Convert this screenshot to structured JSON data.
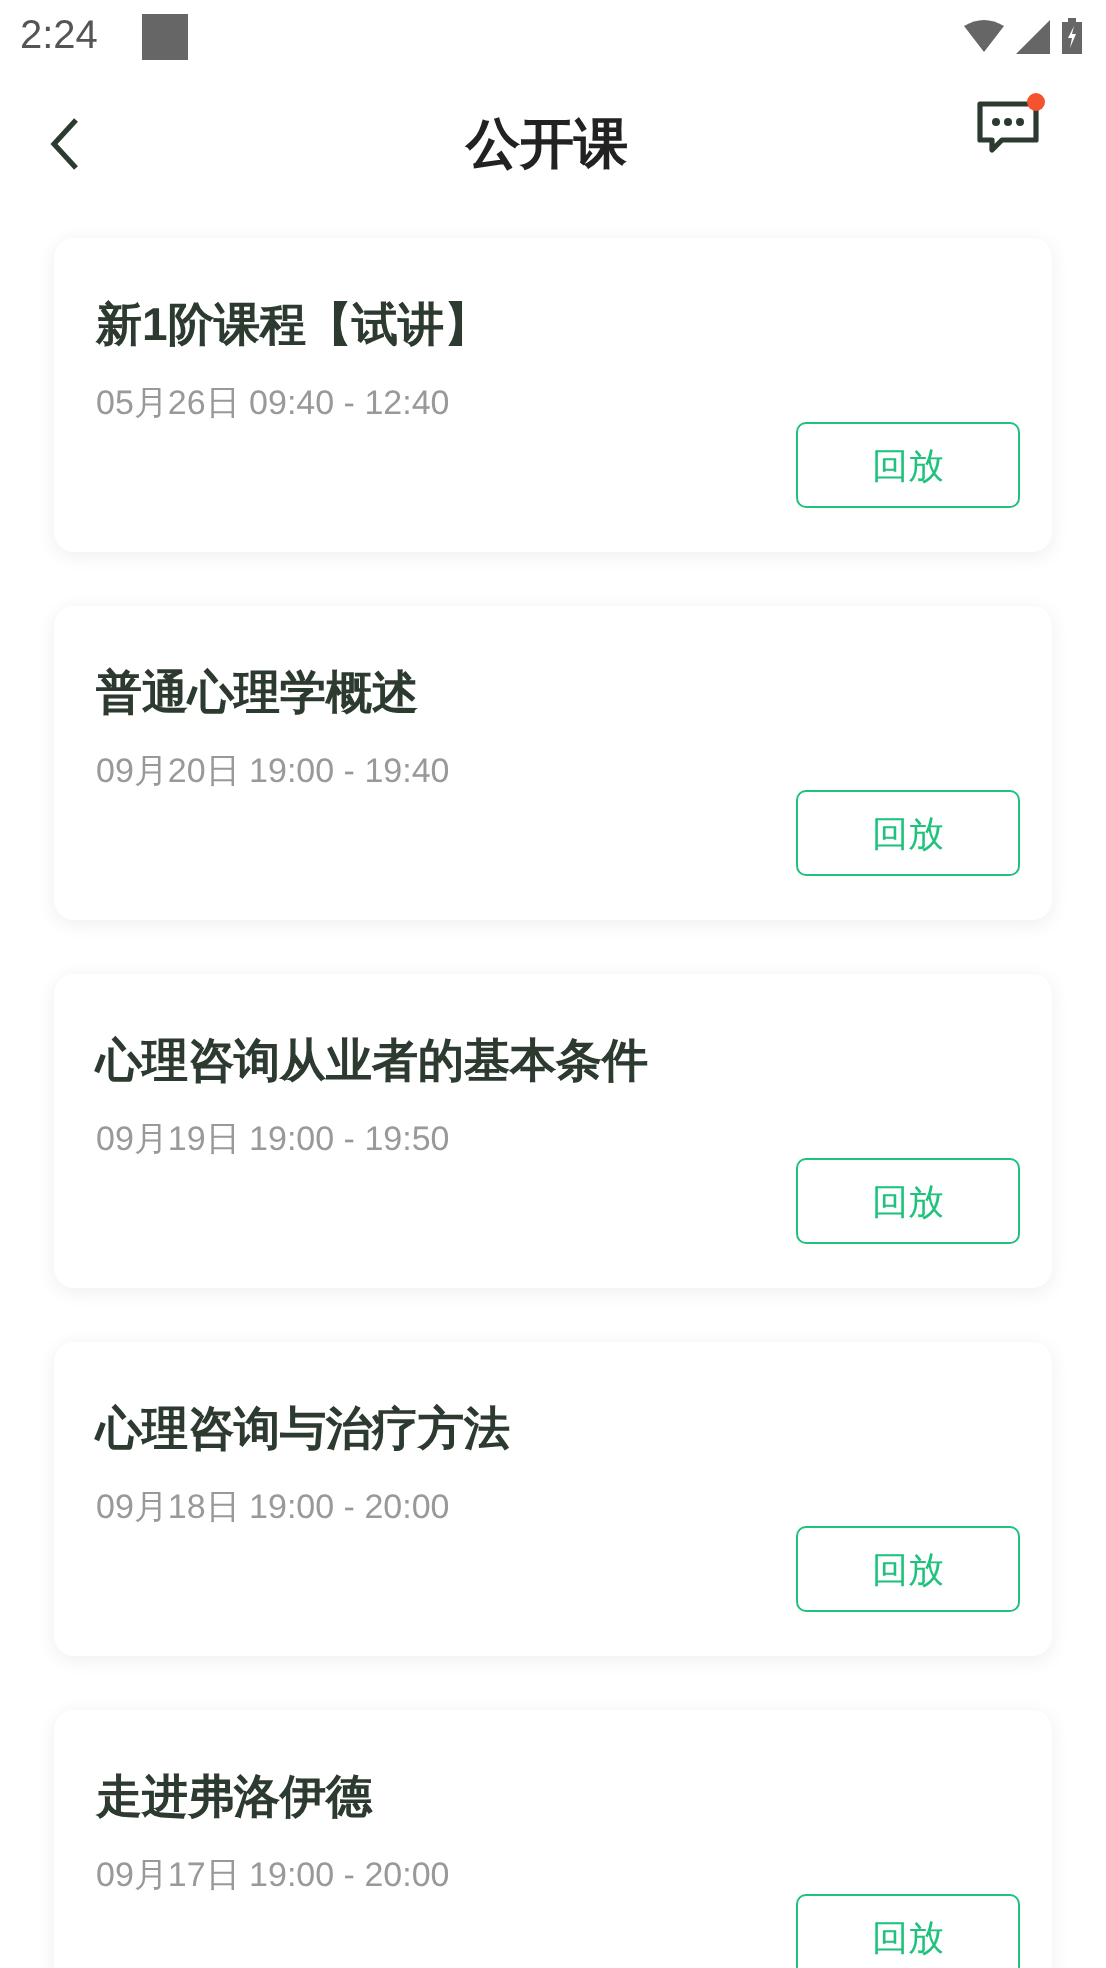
{
  "status_bar": {
    "time": "2:24"
  },
  "header": {
    "title": "公开课",
    "has_unread": true
  },
  "courses": [
    {
      "title": "新1阶课程【试讲】",
      "time": "05月26日 09:40 - 12:40",
      "button": "回放"
    },
    {
      "title": "普通心理学概述",
      "time": "09月20日 19:00 - 19:40",
      "button": "回放"
    },
    {
      "title": "心理咨询从业者的基本条件",
      "time": "09月19日 19:00 - 19:50",
      "button": "回放"
    },
    {
      "title": "心理咨询与治疗方法",
      "time": "09月18日 19:00 - 20:00",
      "button": "回放"
    },
    {
      "title": "走进弗洛伊德",
      "time": "09月17日 19:00 - 20:00",
      "button": "回放"
    }
  ]
}
